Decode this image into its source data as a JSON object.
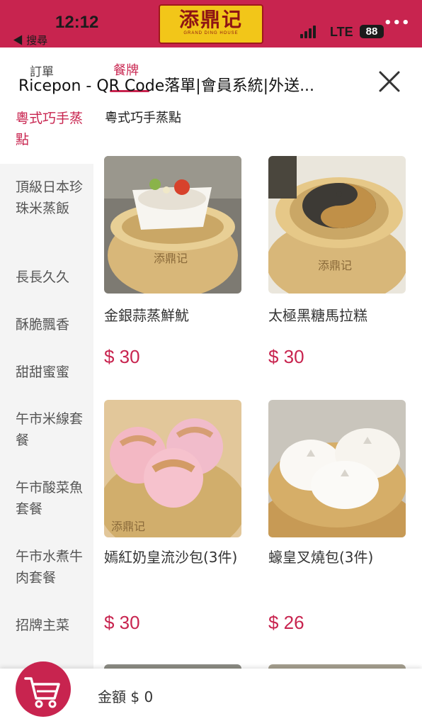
{
  "status_bar": {
    "time": "12:12",
    "back_label": "◀ 搜尋",
    "network": "LTE",
    "battery": "88"
  },
  "logo": {
    "text": "添鼎记",
    "subtitle": "GRAND DING HOUSE"
  },
  "header": {
    "tab_order": "訂單",
    "tab_menu": "餐牌",
    "title": "Ricepon - QR Code落單|會員系統|外送..."
  },
  "sidebar": {
    "items": [
      {
        "label": "粵式巧手蒸點",
        "active": true
      },
      {
        "label": "頂級日本珍珠米蒸飯",
        "active": false
      },
      {
        "label": "長長久久",
        "active": false
      },
      {
        "label": "酥脆飄香",
        "active": false
      },
      {
        "label": "甜甜蜜蜜",
        "active": false
      },
      {
        "label": "午市米線套餐",
        "active": false
      },
      {
        "label": "午市酸菜魚套餐",
        "active": false
      },
      {
        "label": "午市水煮牛肉套餐",
        "active": false
      },
      {
        "label": "招牌主菜",
        "active": false
      }
    ]
  },
  "main": {
    "section_title": "粵式巧手蒸點",
    "items": [
      {
        "name": "金銀蒜蒸鮮魷",
        "price": "$ 30"
      },
      {
        "name": "太極黑糖馬拉糕",
        "price": "$ 30"
      },
      {
        "name": "嫣紅奶皇流沙包(3件)",
        "price": "$ 30"
      },
      {
        "name": "蠔皇叉燒包(3件)",
        "price": "$ 26"
      }
    ]
  },
  "footer": {
    "total": "金額 $ 0"
  },
  "colors": {
    "brand": "#c8244f",
    "logo_bg": "#f2c619",
    "sidebar_bg": "#f4f4f4"
  }
}
